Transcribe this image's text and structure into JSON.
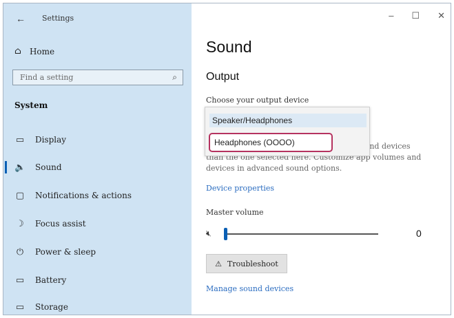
{
  "titlebar": {
    "back_icon": "arrow-left-icon",
    "title": "Settings",
    "minimize": "–",
    "maximize": "☐",
    "close": "✕"
  },
  "sidebar": {
    "home": {
      "icon": "⌂",
      "label": "Home"
    },
    "search": {
      "placeholder": "Find a setting",
      "icon": "⌕"
    },
    "section": "System",
    "items": [
      {
        "icon": "▭",
        "label": "Display"
      },
      {
        "icon": "🔈",
        "label": "Sound",
        "active": true
      },
      {
        "icon": "▢",
        "label": "Notifications & actions"
      },
      {
        "icon": "☽",
        "label": "Focus assist"
      },
      {
        "icon": "⏻",
        "label": "Power & sleep"
      },
      {
        "icon": "▭",
        "label": "Battery"
      },
      {
        "icon": "▭",
        "label": "Storage"
      }
    ]
  },
  "main": {
    "title": "Sound",
    "output_heading": "Output",
    "choose_label": "Choose your output device",
    "dropdown": {
      "selected": "Speaker/Headphones",
      "option_highlighted": "Headphones (OOOO)"
    },
    "related_text": {
      "line1": "sound devices",
      "line2": "than the one selected here. Customize app volumes and",
      "line3": "devices in advanced sound options."
    },
    "device_properties": "Device properties",
    "master_volume_label": "Master volume",
    "mute_icon": "🔇",
    "volume_value": "0",
    "volume_level": 0,
    "troubleshoot": {
      "icon": "⚠",
      "label": "Troubleshoot"
    },
    "manage_link": "Manage sound devices"
  },
  "colors": {
    "sidebar_bg": "#cfe3f3",
    "accent": "#0a5fb4",
    "highlight_border": "#b5325f",
    "link": "#2a6cc0"
  }
}
